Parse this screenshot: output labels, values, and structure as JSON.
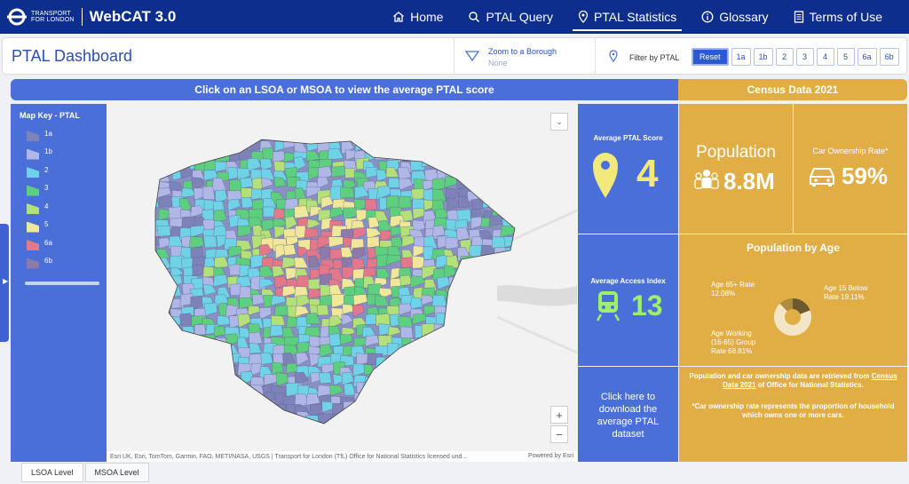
{
  "brand": {
    "org_line1": "TRANSPORT",
    "org_line2": "FOR LONDON",
    "app_title": "WebCAT 3.0"
  },
  "nav": [
    {
      "label": "Home",
      "icon": "home-icon"
    },
    {
      "label": "PTAL Query",
      "icon": "search-icon"
    },
    {
      "label": "PTAL Statistics",
      "icon": "location-pin-icon",
      "active": true
    },
    {
      "label": "Glossary",
      "icon": "info-icon"
    },
    {
      "label": "Terms of Use",
      "icon": "document-icon"
    }
  ],
  "dashboard": {
    "title": "PTAL Dashboard",
    "zoom": {
      "label": "Zoom to a Borough",
      "value": "None"
    },
    "filter": {
      "label": "Filter by PTAL",
      "reset": "Reset",
      "levels": [
        "1a",
        "1b",
        "2",
        "3",
        "4",
        "5",
        "6a",
        "6b"
      ]
    }
  },
  "banner": {
    "left": "Click on an LSOA or MSOA to view the average PTAL score",
    "right": "Census Data 2021"
  },
  "map_key": {
    "title": "Map Key - PTAL",
    "items": [
      {
        "label": "1a",
        "color": "#7d82b8"
      },
      {
        "label": "1b",
        "color": "#aeb7e6"
      },
      {
        "label": "2",
        "color": "#6fd2e6"
      },
      {
        "label": "3",
        "color": "#5ecf7e"
      },
      {
        "label": "4",
        "color": "#b4e07a"
      },
      {
        "label": "5",
        "color": "#f1e79a"
      },
      {
        "label": "6a",
        "color": "#e4788b"
      },
      {
        "label": "6b",
        "color": "#8e7aa8"
      }
    ]
  },
  "map": {
    "attribution": "Esri UK, Esri, TomTom, Garmin, FAO, METI/NASA, USGS | Transport for London (TfL) Office for National Statistics licensed und...",
    "powered": "Powered by Esri",
    "zoom_in": "+",
    "zoom_out": "−",
    "collapse": "⌄"
  },
  "stats": {
    "avg_ptal": {
      "label": "Average PTAL Score",
      "value": "4"
    },
    "avg_access": {
      "label": "Average Access Index",
      "value": "13"
    },
    "download": "Click here to download the average PTAL dataset",
    "population": {
      "label": "Population",
      "value": "8.8M"
    },
    "car": {
      "label": "Car Ownership Rate*",
      "value": "59%"
    },
    "age": {
      "title": "Population by Age",
      "over65": {
        "line1": "Age 65+ Rate",
        "line2": "12.08%",
        "value": 12.08
      },
      "under15": {
        "line1": "Age 15 Below",
        "line2": "Rate 19.11%",
        "value": 19.11
      },
      "working": {
        "line1": "Age Working",
        "line2": "(16-65) Group",
        "line3": "Rate 68.81%",
        "value": 68.81
      }
    },
    "info": {
      "p1_a": "Population and car ownership data are retrieved from",
      "p1_link": "Census Data 2021",
      "p1_b": " of Office for National Statistics.",
      "p2": "*Car ownership rate represents the proportion of household which owns one or more cars."
    }
  },
  "bottom_tabs": [
    "LSOA Level",
    "MSOA Level"
  ]
}
